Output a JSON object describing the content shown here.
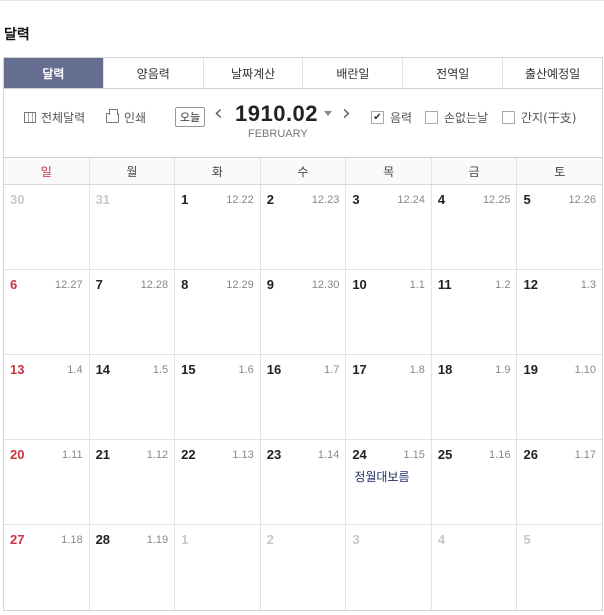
{
  "page": {
    "title": "달력"
  },
  "tabs": [
    {
      "label": "달력",
      "active": true
    },
    {
      "label": "양음력",
      "active": false
    },
    {
      "label": "날짜계산",
      "active": false
    },
    {
      "label": "배란일",
      "active": false
    },
    {
      "label": "전역일",
      "active": false
    },
    {
      "label": "출산예정일",
      "active": false
    }
  ],
  "toolbar": {
    "full_calendar": "전체달력",
    "print": "인쇄",
    "today": "오늘",
    "prev_icon": "chevron-left-icon",
    "next_icon": "chevron-right-icon",
    "year_month": "1910.02",
    "month_en": "FEBRUARY",
    "options": [
      {
        "label": "음력",
        "checked": true
      },
      {
        "label": "손없는날",
        "checked": false
      },
      {
        "label": "간지(干支)",
        "checked": false
      }
    ]
  },
  "weekdays": [
    "일",
    "월",
    "화",
    "수",
    "목",
    "금",
    "토"
  ],
  "colors": {
    "accent": "#656e90",
    "sunday": "#c8343f",
    "event": "#1d2a66"
  },
  "weeks": [
    [
      {
        "day": "30",
        "lunar": "",
        "other": true
      },
      {
        "day": "31",
        "lunar": "",
        "other": true
      },
      {
        "day": "1",
        "lunar": "12.22"
      },
      {
        "day": "2",
        "lunar": "12.23"
      },
      {
        "day": "3",
        "lunar": "12.24"
      },
      {
        "day": "4",
        "lunar": "12.25"
      },
      {
        "day": "5",
        "lunar": "12.26"
      }
    ],
    [
      {
        "day": "6",
        "lunar": "12.27"
      },
      {
        "day": "7",
        "lunar": "12.28"
      },
      {
        "day": "8",
        "lunar": "12.29"
      },
      {
        "day": "9",
        "lunar": "12.30"
      },
      {
        "day": "10",
        "lunar": "1.1"
      },
      {
        "day": "11",
        "lunar": "1.2"
      },
      {
        "day": "12",
        "lunar": "1.3"
      }
    ],
    [
      {
        "day": "13",
        "lunar": "1.4"
      },
      {
        "day": "14",
        "lunar": "1.5"
      },
      {
        "day": "15",
        "lunar": "1.6"
      },
      {
        "day": "16",
        "lunar": "1.7"
      },
      {
        "day": "17",
        "lunar": "1.8"
      },
      {
        "day": "18",
        "lunar": "1.9"
      },
      {
        "day": "19",
        "lunar": "1.10"
      }
    ],
    [
      {
        "day": "20",
        "lunar": "1.11"
      },
      {
        "day": "21",
        "lunar": "1.12"
      },
      {
        "day": "22",
        "lunar": "1.13"
      },
      {
        "day": "23",
        "lunar": "1.14"
      },
      {
        "day": "24",
        "lunar": "1.15",
        "event": "정월대보름"
      },
      {
        "day": "25",
        "lunar": "1.16"
      },
      {
        "day": "26",
        "lunar": "1.17"
      }
    ],
    [
      {
        "day": "27",
        "lunar": "1.18"
      },
      {
        "day": "28",
        "lunar": "1.19"
      },
      {
        "day": "1",
        "lunar": "",
        "other": true
      },
      {
        "day": "2",
        "lunar": "",
        "other": true
      },
      {
        "day": "3",
        "lunar": "",
        "other": true
      },
      {
        "day": "4",
        "lunar": "",
        "other": true
      },
      {
        "day": "5",
        "lunar": "",
        "other": true
      }
    ]
  ]
}
